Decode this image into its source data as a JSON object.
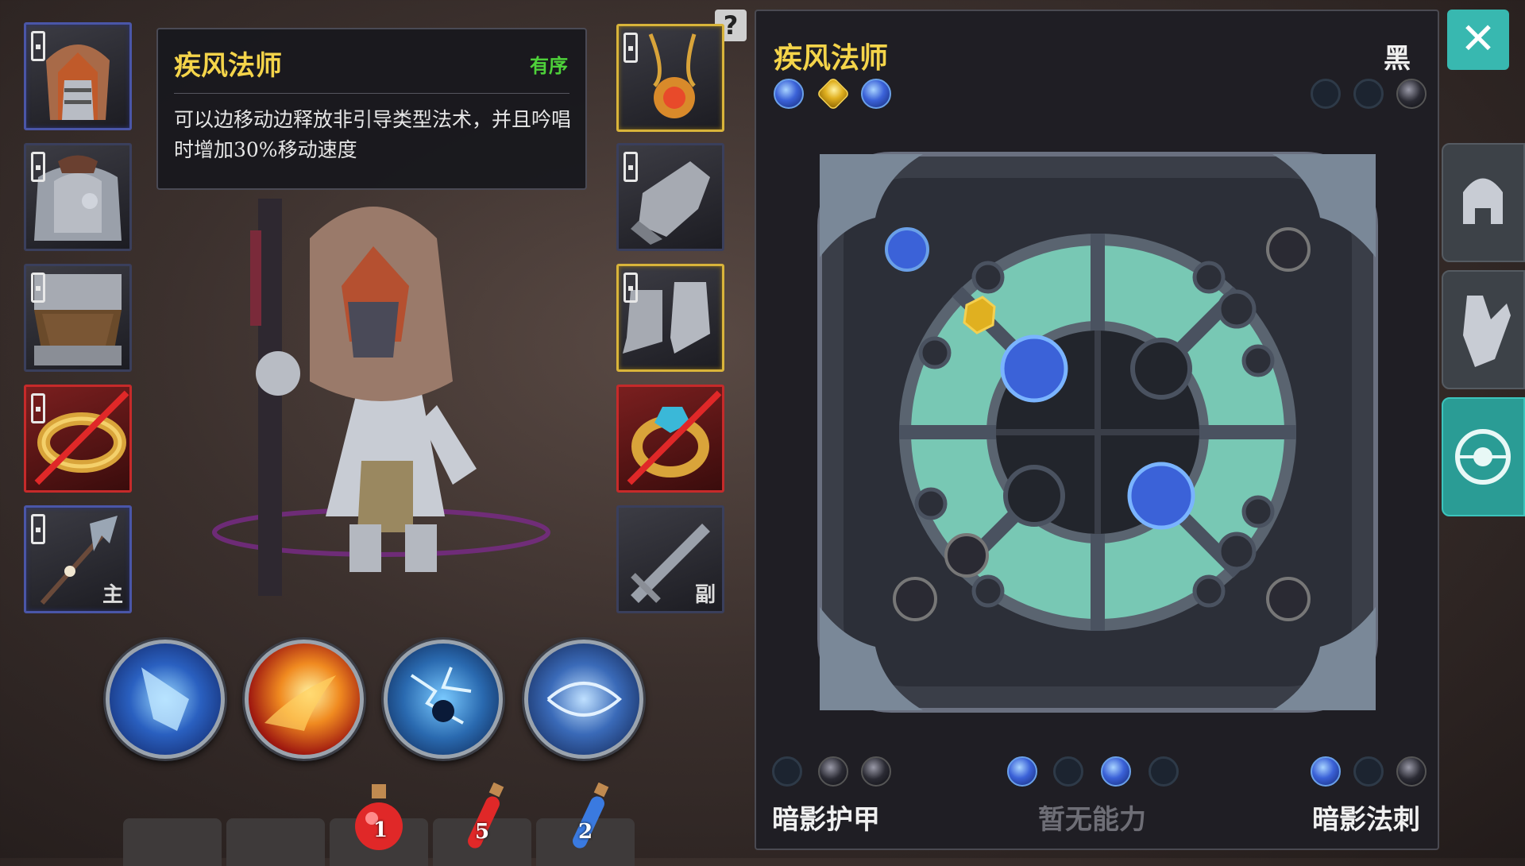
{
  "tooltip": {
    "title": "疾风法师",
    "tag": "有序",
    "description": "可以边移动边释放非引导类型法术，并且吟唱时增加30%移动速度"
  },
  "help_icon": "?",
  "equipment": {
    "left": [
      {
        "name": "helmet",
        "icon": "hood-helmet-icon",
        "frame": "blue",
        "locked": true
      },
      {
        "name": "chest",
        "icon": "chest-armor-icon",
        "frame": "dark",
        "locked": true
      },
      {
        "name": "legs",
        "icon": "leg-armor-icon",
        "frame": "dark",
        "locked": true
      },
      {
        "name": "ring",
        "icon": "ring-icon",
        "frame": "red",
        "locked": true,
        "forbidden": true
      },
      {
        "name": "main-weapon",
        "icon": "staff-icon",
        "frame": "blue",
        "locked": true,
        "label": "主"
      }
    ],
    "right": [
      {
        "name": "amulet",
        "icon": "amulet-icon",
        "frame": "gold",
        "locked": true
      },
      {
        "name": "gloves",
        "icon": "gauntlet-icon",
        "frame": "dark",
        "locked": true
      },
      {
        "name": "boots",
        "icon": "boots-icon",
        "frame": "gold",
        "locked": true
      },
      {
        "name": "ring-2",
        "icon": "gem-ring-icon",
        "frame": "red",
        "locked": false,
        "forbidden": true
      },
      {
        "name": "off-weapon",
        "icon": "sword-icon",
        "frame": "dark",
        "locked": false,
        "label": "副"
      }
    ]
  },
  "skills": [
    {
      "name": "ice-shard",
      "icon": "ice-shard-icon"
    },
    {
      "name": "fireball",
      "icon": "fireball-icon"
    },
    {
      "name": "chain-lightning",
      "icon": "lightning-icon"
    },
    {
      "name": "wind-blast",
      "icon": "wind-icon"
    }
  ],
  "potions": [
    {
      "color": "red",
      "count": "1",
      "icon": "health-potion-icon"
    },
    {
      "color": "red",
      "count": "5",
      "icon": "red-vial-icon"
    },
    {
      "color": "blue",
      "count": "2",
      "icon": "mana-vial-icon"
    }
  ],
  "panel": {
    "title": "疾风法师",
    "tag": "黑",
    "top_left_gems": [
      "blue",
      "gold",
      "blue"
    ],
    "top_right_gems": [
      "empty",
      "empty",
      "dark"
    ],
    "bottom_groups": [
      {
        "label": "暗影护甲",
        "label_color": "#f0f0f0",
        "gems": [
          "empty",
          "dark",
          "dark"
        ]
      },
      {
        "label": "暂无能力",
        "label_color": "#6e6e76",
        "gems": [
          "blue",
          "empty",
          "blue",
          "empty"
        ]
      },
      {
        "label": "暗影法刺",
        "label_color": "#f0f0f0",
        "gems": [
          "blue",
          "empty",
          "dark"
        ]
      }
    ]
  },
  "colors": {
    "accent_teal": "#38b8b0",
    "title_gold": "#f4d44a",
    "tag_green": "#4ed13a",
    "forbid_red": "#e02828"
  },
  "side_tabs": [
    {
      "name": "helmet-tab",
      "icon": "helmet-icon",
      "active": false
    },
    {
      "name": "gloves-tab",
      "icon": "glove-icon",
      "active": false
    },
    {
      "name": "rune-tab",
      "icon": "rune-icon",
      "active": true
    }
  ],
  "close_icon": "✕"
}
